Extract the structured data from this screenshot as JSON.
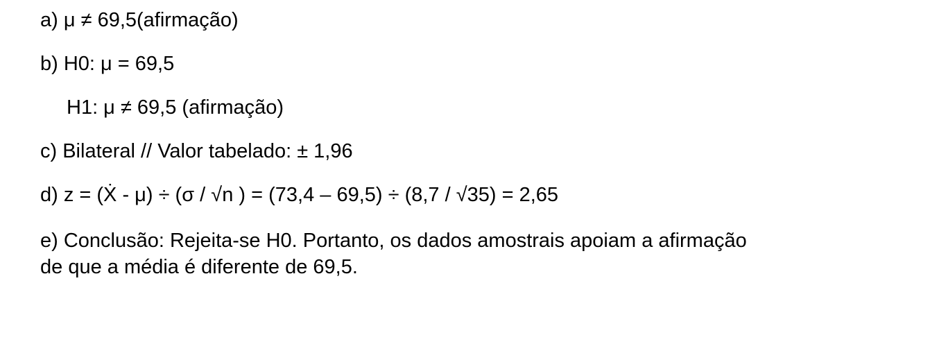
{
  "items": {
    "a": "a) μ ≠ 69,5(afirmação)",
    "b": "b) H0: μ = 69,5",
    "h1": "H1: μ ≠ 69,5 (afirmação)",
    "c": "c) Bilateral // Valor tabelado: ± 1,96",
    "d": "d) z = (Ẋ - μ) ÷ (σ / √n ) = (73,4 – 69,5) ÷ (8,7 / √35) = 2,65",
    "e_line1": "e) Conclusão: Rejeita-se H0. Portanto, os dados amostrais apoiam a afirmação",
    "e_line2": "de que a média é diferente de 69,5."
  }
}
